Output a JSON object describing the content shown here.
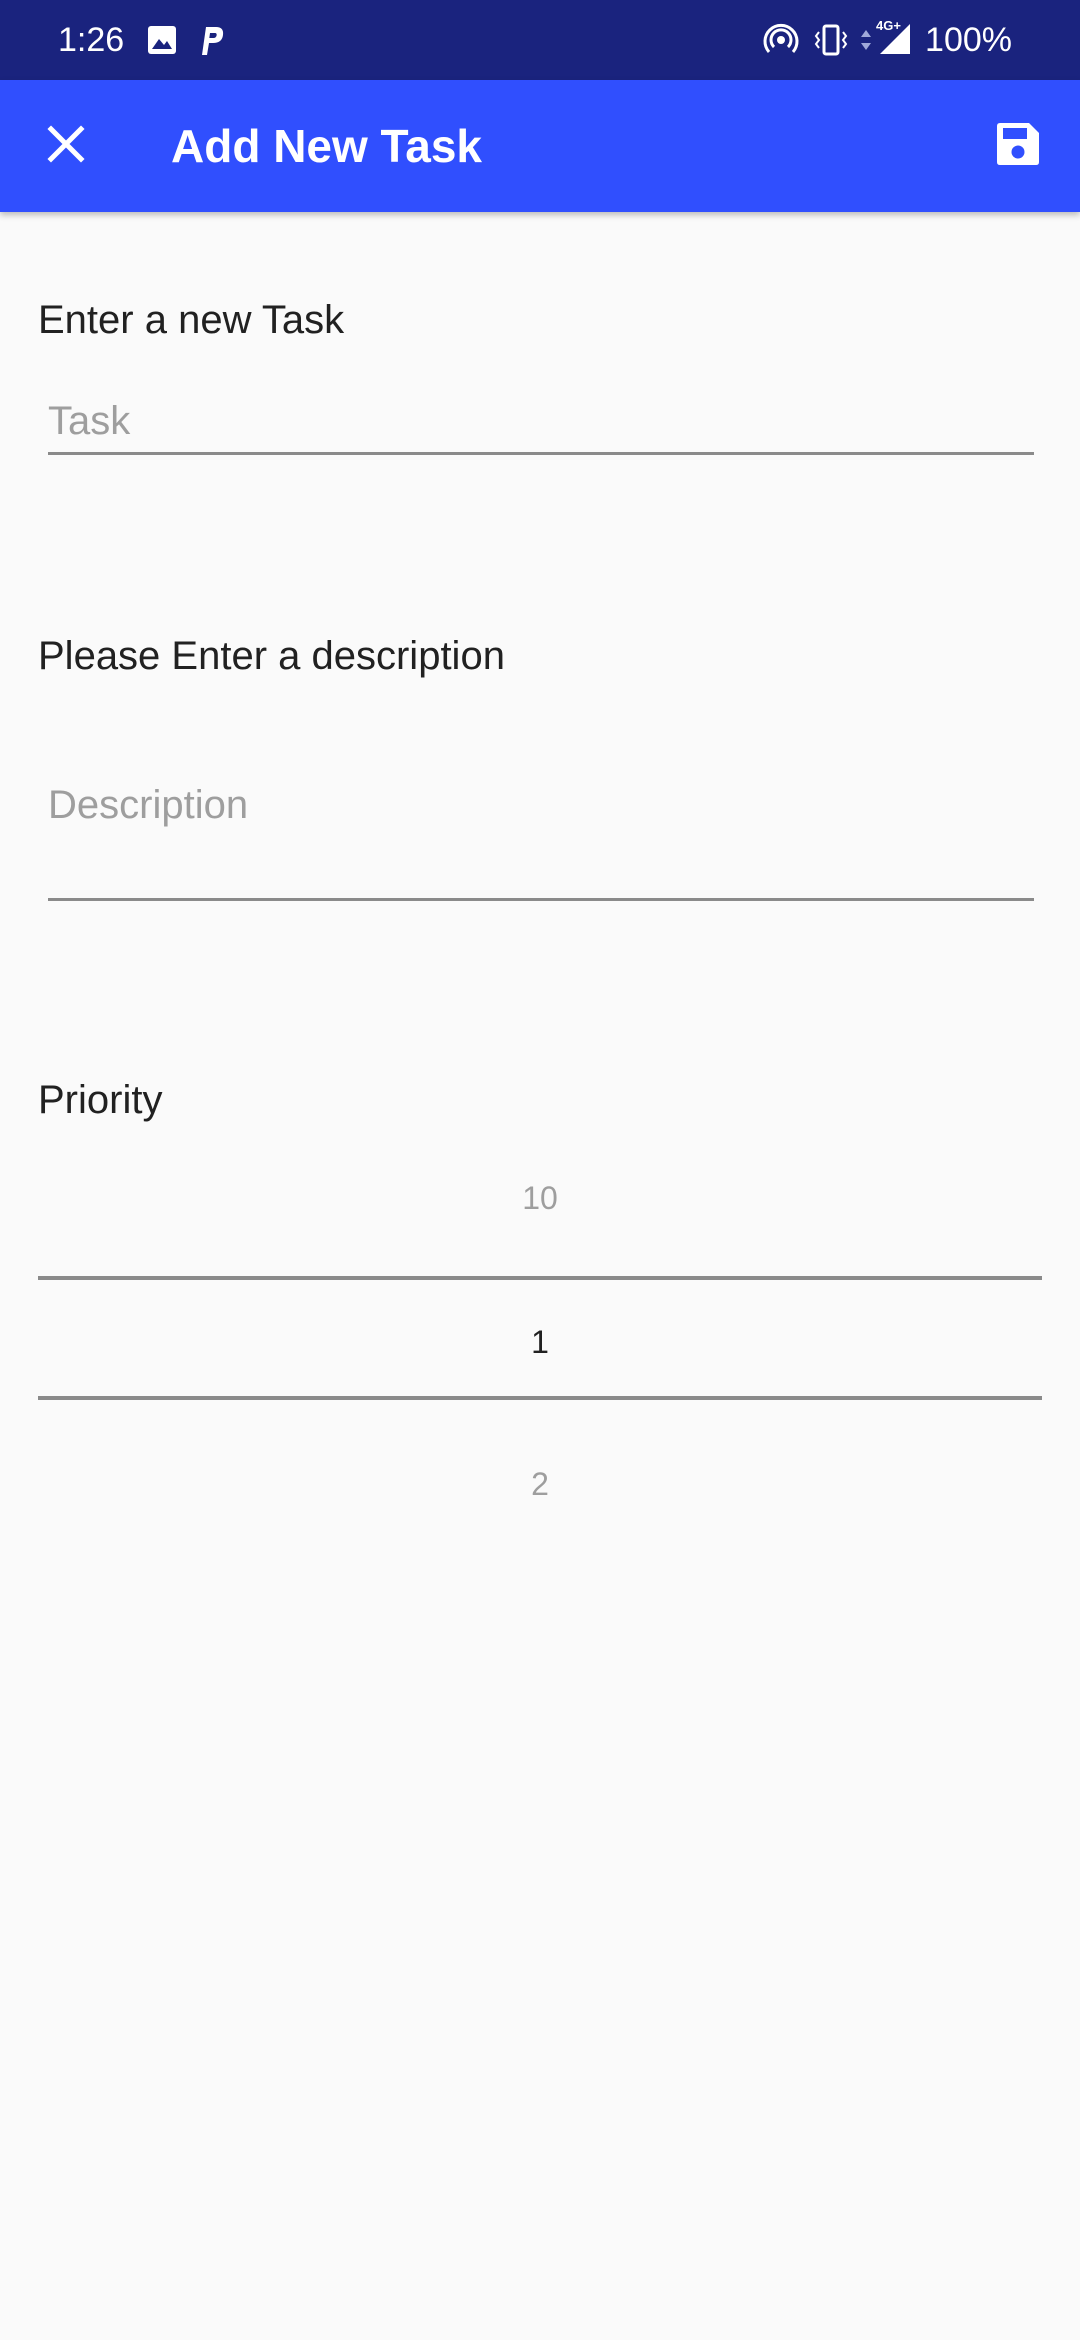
{
  "status_bar": {
    "time": "1:26",
    "battery": "100%",
    "network": "4G+",
    "icons": [
      "image-icon",
      "p-app-icon",
      "hotspot-icon",
      "vibrate-icon",
      "data-arrows-icon",
      "signal-icon"
    ]
  },
  "app_bar": {
    "title": "Add New Task",
    "close_icon": "close-icon",
    "save_icon": "save-icon",
    "color": "#304ffe"
  },
  "form": {
    "task_label": "Enter a new Task",
    "task_placeholder": "Task",
    "task_value": "",
    "description_label": "Please Enter a description",
    "description_placeholder": "Description",
    "description_value": "",
    "priority_label": "Priority",
    "priority_picker": {
      "previous": "10",
      "selected": "1",
      "next": "2"
    }
  },
  "colors": {
    "status_bar": "#1a237e",
    "app_bar": "#304ffe",
    "background": "#fafafa",
    "underline": "#8a8a8a"
  }
}
